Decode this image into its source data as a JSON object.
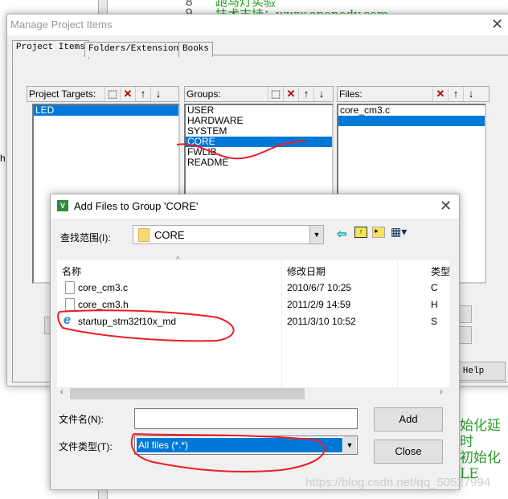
{
  "editor": {
    "line_numbers": [
      "8",
      "9"
    ],
    "code_top": [
      "跑马灯实验",
      "技术支持：www.openedv.com"
    ],
    "code_bottom": [
      "始化延时",
      "初始化LE"
    ],
    "left_char": "h"
  },
  "manage": {
    "title": "Manage Project Items",
    "tabs": [
      {
        "label": "Project Items"
      },
      {
        "label": "Folders/Extensions"
      },
      {
        "label": "Books"
      }
    ],
    "targets": {
      "label": "Project Targets:",
      "items": [
        "LED"
      ],
      "selected": "LED"
    },
    "groups": {
      "label": "Groups:",
      "items": [
        "USER",
        "HARDWARE",
        "SYSTEM",
        "CORE",
        "FWLIB",
        "README"
      ],
      "selected": "CORE"
    },
    "files": {
      "label": "Files:",
      "items": [
        "core_cm3.c",
        ""
      ]
    },
    "help_label": "Help"
  },
  "add": {
    "title": "Add Files to Group 'CORE'",
    "lookin_label": "查找范围(I):",
    "lookin_value": "CORE",
    "columns": [
      "名称",
      "修改日期",
      "类型"
    ],
    "rows": [
      {
        "name": "core_cm3.c",
        "date": "2010/6/7 10:25",
        "type": "C",
        "icon": "file-icon"
      },
      {
        "name": "core_cm3.h",
        "date": "2011/2/9 14:59",
        "type": "H",
        "icon": "file-icon"
      },
      {
        "name": "startup_stm32f10x_md",
        "date": "2011/3/10 10:52",
        "type": "S",
        "icon": "ie-file-icon"
      }
    ],
    "filename_label": "文件名(N):",
    "filename_value": "",
    "filetype_label": "文件类型(T):",
    "filetype_value": "All files (*.*)",
    "add_label": "Add",
    "close_label": "Close"
  },
  "watermark": "https://blog.csdn.net/qq_50527994",
  "colors": {
    "selection": "#0078d7",
    "annotation": "#ee1c25",
    "code": "#1a9c1a"
  }
}
